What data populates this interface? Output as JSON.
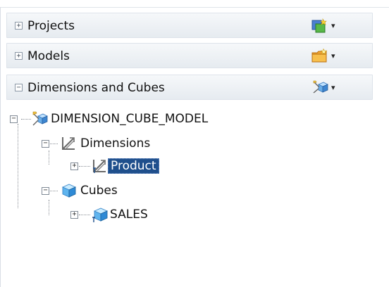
{
  "sections": [
    {
      "toggle": "+",
      "label": "Projects",
      "icon": "new-project-icon",
      "arrow": "▾"
    },
    {
      "toggle": "+",
      "label": "Models",
      "icon": "new-model-folder-icon",
      "arrow": "▾"
    },
    {
      "toggle": "−",
      "label": "Dimensions and Cubes",
      "icon": "dimension-cube-icon",
      "arrow": "▾"
    }
  ],
  "tree": {
    "root": {
      "label": "DIMENSION_CUBE_MODEL",
      "expander": "−"
    },
    "dimensions": {
      "label": "Dimensions",
      "expander": "−"
    },
    "product": {
      "label": "Product",
      "expander": "+"
    },
    "cubes": {
      "label": "Cubes",
      "expander": "−"
    },
    "sales": {
      "label": "SALES",
      "expander": "+"
    }
  },
  "colors": {
    "selection": "#1f4f8c",
    "header_top": "#f6f8fa",
    "header_bottom": "#e6ebf0"
  }
}
